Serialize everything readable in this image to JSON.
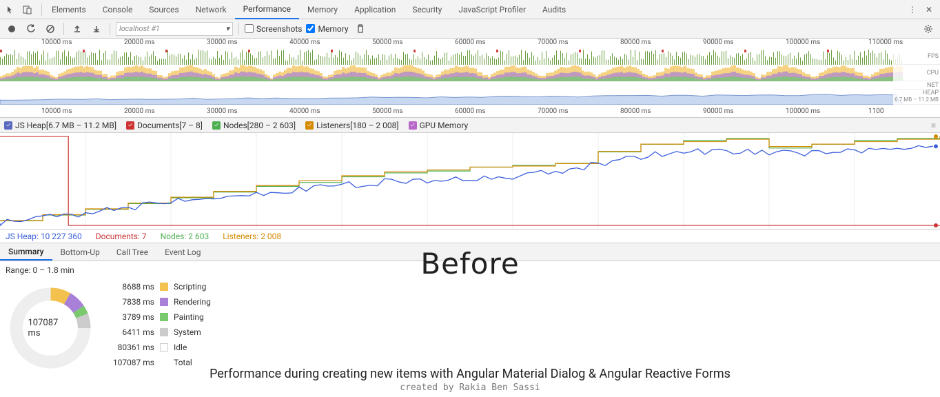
{
  "tabs": [
    "Elements",
    "Console",
    "Sources",
    "Network",
    "Performance",
    "Memory",
    "Application",
    "Security",
    "JavaScript Profiler",
    "Audits"
  ],
  "active_tab": "Performance",
  "toolbar": {
    "recording_select": "localhost #1",
    "screenshots_label": "Screenshots",
    "screenshots_checked": false,
    "memory_label": "Memory",
    "memory_checked": true
  },
  "overview": {
    "ruler_marks": [
      "10000 ms",
      "20000 ms",
      "30000 ms",
      "40000 ms",
      "50000 ms",
      "60000 ms",
      "70000 ms",
      "80000 ms",
      "90000 ms",
      "100000 ms",
      "110000 ms"
    ],
    "side_labels": [
      "FPS",
      "CPU",
      "NET",
      "HEAP"
    ],
    "heap_range": "6.7 MB – 11.2 MB",
    "bottom_ruler": [
      "10000 ms",
      "20000 ms",
      "30000 ms",
      "40000 ms",
      "50000 ms",
      "60000 ms",
      "70000 ms",
      "80000 ms",
      "90000 ms",
      "100000 ms",
      "1100"
    ]
  },
  "legend": [
    {
      "label": "JS Heap[6.7 MB – 11.2 MB]",
      "color": "#5b6abf",
      "checked": true
    },
    {
      "label": "Documents[7 – 8]",
      "color": "#cc3333",
      "checked": true
    },
    {
      "label": "Nodes[280 – 2 603]",
      "color": "#4CAF50",
      "checked": true
    },
    {
      "label": "Listeners[180 – 2 008]",
      "color": "#d68a00",
      "checked": true
    },
    {
      "label": "GPU Memory",
      "color": "#b868c8",
      "checked": true
    }
  ],
  "chart_data": {
    "type": "line",
    "xlim": [
      0,
      110000
    ],
    "ylim_heap": [
      6700000,
      11200000
    ],
    "ylim_docs": [
      7,
      8
    ],
    "ylim_nodes": [
      280,
      2603
    ],
    "ylim_listeners": [
      180,
      2008
    ],
    "series": [
      {
        "name": "JS Heap",
        "color": "#3a5edc",
        "unit": "bytes",
        "x": [
          0,
          5000,
          10000,
          15000,
          20000,
          25000,
          30000,
          35000,
          40000,
          45000,
          50000,
          55000,
          60000,
          65000,
          70000,
          75000,
          80000,
          85000,
          90000,
          95000,
          100000,
          105000,
          110000
        ],
        "y": [
          6800000,
          7100000,
          7300000,
          7600000,
          7900000,
          8100000,
          8300000,
          8500000,
          8700000,
          8900000,
          9000000,
          9100000,
          9200000,
          9400000,
          9800000,
          10200000,
          10400000,
          10500000,
          10300000,
          10400000,
          10500000,
          10600000,
          10700000
        ]
      },
      {
        "name": "Documents",
        "color": "#cc3333",
        "unit": "count",
        "x": [
          0,
          8000,
          8001,
          110000
        ],
        "y": [
          8,
          8,
          7,
          7
        ]
      },
      {
        "name": "Nodes",
        "color": "#4CAF50",
        "unit": "count",
        "x": [
          0,
          5000,
          10000,
          15000,
          20000,
          25000,
          30000,
          35000,
          40000,
          45000,
          50000,
          55000,
          60000,
          65000,
          70000,
          75000,
          80000,
          85000,
          90000,
          95000,
          100000,
          105000,
          110000
        ],
        "y": [
          400,
          550,
          700,
          850,
          1000,
          1150,
          1300,
          1400,
          1550,
          1650,
          1700,
          1800,
          1850,
          1900,
          2200,
          2400,
          2500,
          2550,
          2300,
          2400,
          2500,
          2550,
          2603
        ]
      },
      {
        "name": "Listeners",
        "color": "#d68a00",
        "unit": "count",
        "x": [
          0,
          5000,
          10000,
          15000,
          20000,
          25000,
          30000,
          35000,
          40000,
          45000,
          50000,
          55000,
          60000,
          65000,
          70000,
          75000,
          80000,
          85000,
          90000,
          95000,
          100000,
          105000,
          110000
        ],
        "y": [
          280,
          400,
          520,
          640,
          760,
          880,
          1000,
          1100,
          1200,
          1280,
          1320,
          1380,
          1400,
          1450,
          1700,
          1850,
          1900,
          1950,
          1800,
          1850,
          1900,
          1950,
          2008
        ]
      }
    ]
  },
  "counters": {
    "jsheap_label": "JS Heap:",
    "jsheap_value": "10 227 360",
    "docs_label": "Documents:",
    "docs_value": "7",
    "nodes_label": "Nodes:",
    "nodes_value": "2 603",
    "listeners_label": "Listeners:",
    "listeners_value": "2 008"
  },
  "big_label": "Before",
  "sub_tabs": [
    "Summary",
    "Bottom-Up",
    "Call Tree",
    "Event Log"
  ],
  "active_sub_tab": "Summary",
  "range_text": "Range: 0 – 1.8 min",
  "donut_center": "107087 ms",
  "breakdown": [
    {
      "ms": "8688 ms",
      "label": "Scripting",
      "color": "#f2c14e"
    },
    {
      "ms": "7838 ms",
      "label": "Rendering",
      "color": "#a880d8"
    },
    {
      "ms": "3789 ms",
      "label": "Painting",
      "color": "#7bc96f"
    },
    {
      "ms": "6411 ms",
      "label": "System",
      "color": "#cccccc"
    },
    {
      "ms": "80361 ms",
      "label": "Idle",
      "color": "#ffffff"
    },
    {
      "ms": "107087 ms",
      "label": "Total",
      "color": ""
    }
  ],
  "caption1": "Performance during creating new items with Angular Material Dialog & Angular Reactive Forms",
  "caption2": "created by Rakia Ben Sassi"
}
